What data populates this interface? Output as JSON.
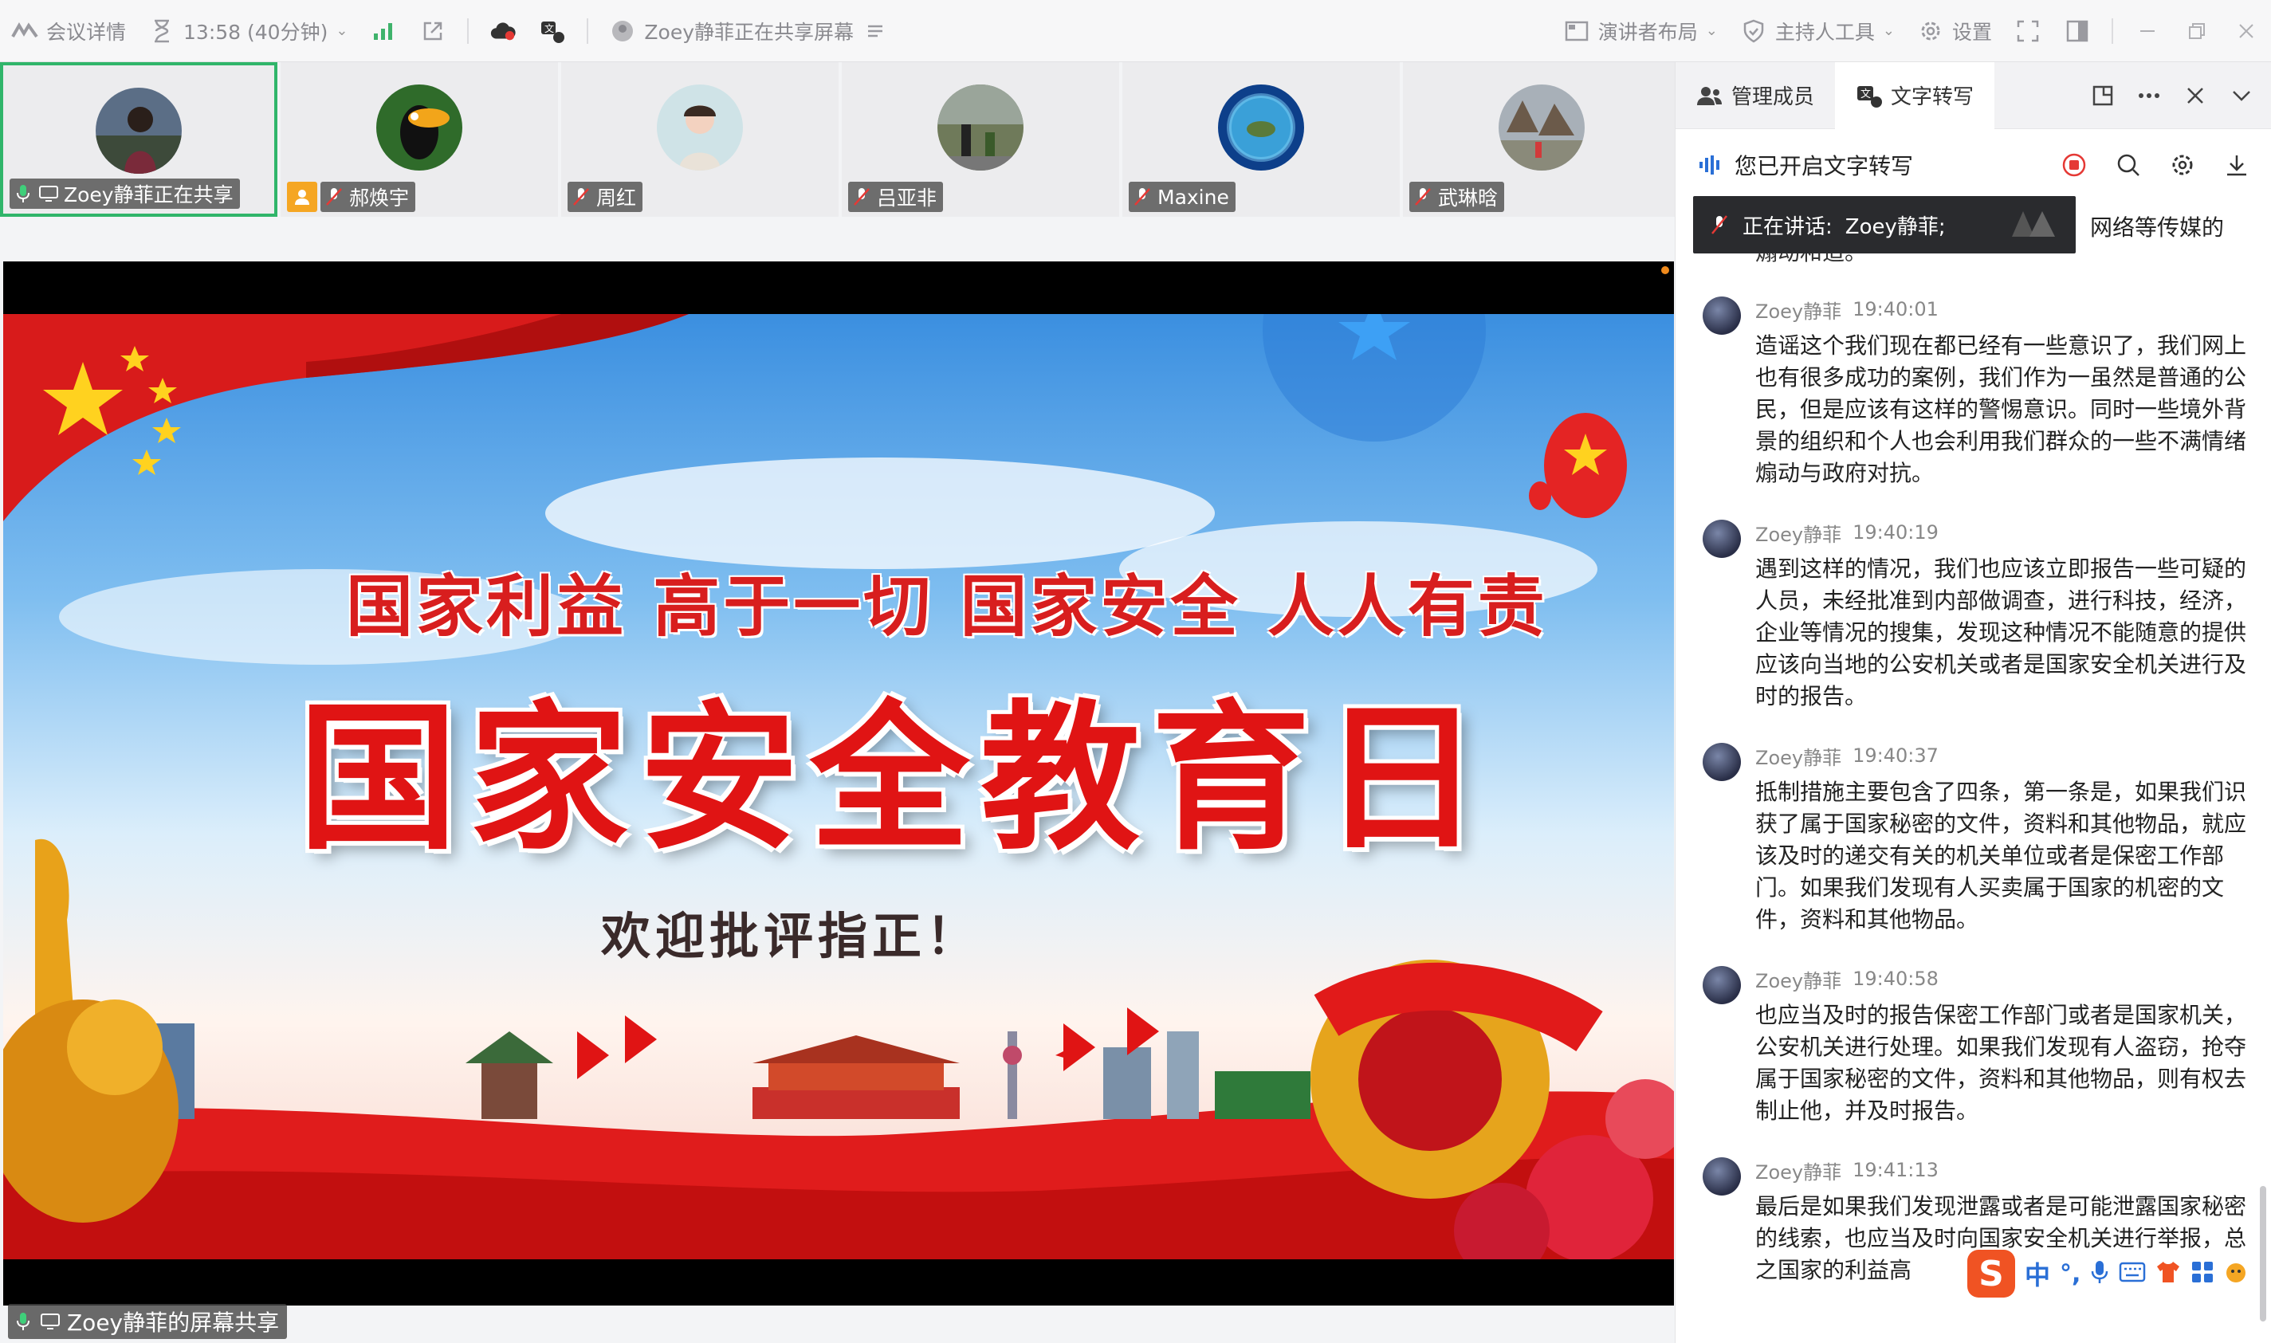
{
  "topbar": {
    "meeting_details": "会议详情",
    "time": "13:58 (40分钟)",
    "sharing_status": "Zoey静菲正在共享屏幕",
    "speaker_layout": "演讲者布局",
    "host_tools": "主持人工具",
    "settings": "设置"
  },
  "participants": [
    {
      "name": "Zoey静菲正在共享",
      "active": true
    },
    {
      "name": "郝焕宇",
      "host": true
    },
    {
      "name": "周红"
    },
    {
      "name": "吕亚非"
    },
    {
      "name": "Maxine"
    },
    {
      "name": "武琳晗"
    }
  ],
  "slide": {
    "slogan": "国家利益 高于一切 国家安全 人人有责",
    "title": "国家安全教育日",
    "welcome": "欢迎批评指正！"
  },
  "share_label": "Zoey静菲的屏幕共享",
  "panel": {
    "tab_members": "管理成员",
    "tab_transcript": "文字转写",
    "transcript_status": "您已开启文字转写",
    "speaking_label": "正在讲话:",
    "speaking_name": "Zoey静菲;",
    "overflow_text": "网络等传媒的",
    "prev_text": "煽动和造。",
    "entries": [
      {
        "speaker": "Zoey静菲",
        "time": "19:40:01",
        "text": "造谣这个我们现在都已经有一些意识了，我们网上也有很多成功的案例，我们作为一虽然是普通的公民，但是应该有这样的警惕意识。同时一些境外背景的组织和个人也会利用我们群众的一些不满情绪煽动与政府对抗。"
      },
      {
        "speaker": "Zoey静菲",
        "time": "19:40:19",
        "text": "遇到这样的情况，我们也应该立即报告一些可疑的人员，未经批准到内部做调查，进行科技，经济，企业等情况的搜集，发现这种情况不能随意的提供应该向当地的公安机关或者是国家安全机关进行及时的报告。"
      },
      {
        "speaker": "Zoey静菲",
        "time": "19:40:37",
        "text": "抵制措施主要包含了四条，第一条是，如果我们识获了属于国家秘密的文件，资料和其他物品，就应该及时的递交有关的机关单位或者是保密工作部门。如果我们发现有人买卖属于国家的机密的文件，资料和其他物品。"
      },
      {
        "speaker": "Zoey静菲",
        "time": "19:40:58",
        "text": "也应当及时的报告保密工作部门或者是国家机关，公安机关进行处理。如果我们发现有人盗窃，抢夺属于国家秘密的文件，资料和其他物品，则有权去制止他，并及时报告。"
      },
      {
        "speaker": "Zoey静菲",
        "time": "19:41:13",
        "text": "最后是如果我们发现泄露或者是可能泄露国家秘密的线索，也应当及时向国家安全机关进行举报，总之国家的利益高"
      }
    ]
  },
  "ime": {
    "lang": "中"
  },
  "colors": {
    "active_border": "#30b56a",
    "host_badge": "#f5a623",
    "record_red": "#e53935",
    "slide_red": "#e01414"
  }
}
